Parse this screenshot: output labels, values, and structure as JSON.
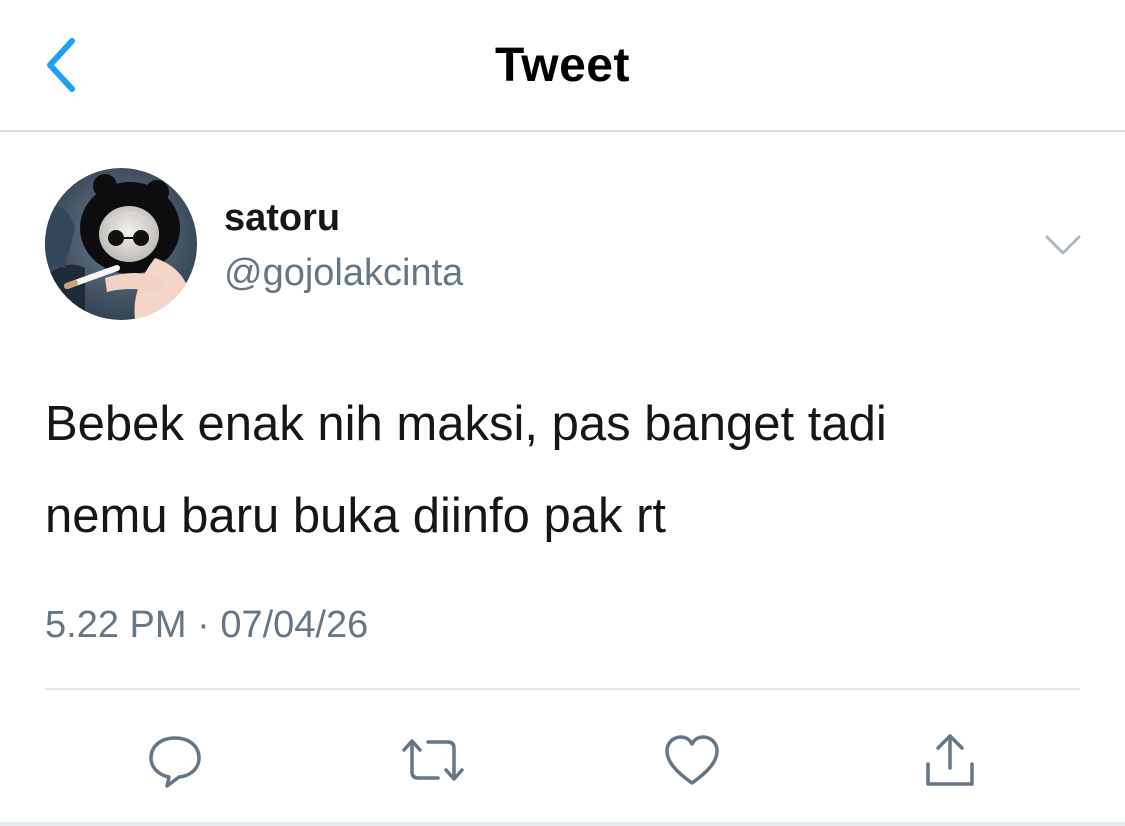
{
  "header": {
    "title": "Tweet",
    "back_icon": "chevron-left-icon",
    "accent_color": "#1da1f2"
  },
  "tweet": {
    "author": {
      "display_name": "satoru",
      "handle": "@gojolakcinta"
    },
    "text": "Bebek enak nih maksi, pas banget tadi\nnemu baru buka diinfo pak rt",
    "time": "5.22 PM",
    "separator": "·",
    "date": "07/04/26"
  },
  "actions": [
    {
      "icon": "reply-icon"
    },
    {
      "icon": "retweet-icon"
    },
    {
      "icon": "like-icon"
    },
    {
      "icon": "share-icon"
    }
  ]
}
